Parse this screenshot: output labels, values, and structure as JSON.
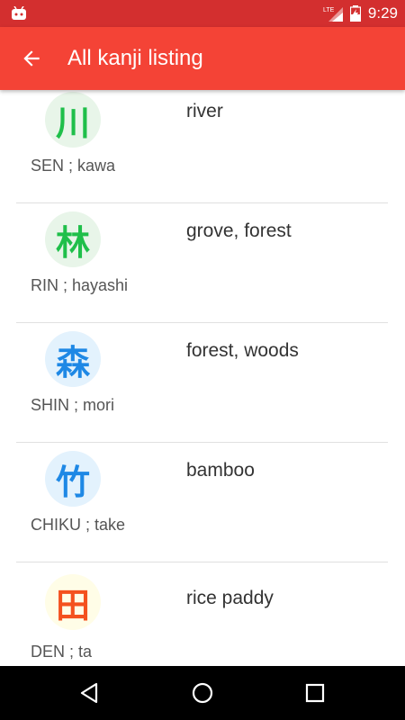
{
  "status_bar": {
    "time": "9:29",
    "network": "LTE"
  },
  "app_bar": {
    "title": "All kanji listing",
    "back_icon": "arrow-back-icon"
  },
  "items": [
    {
      "kanji": "川",
      "meaning": "river",
      "reading": "SEN ; kawa",
      "color": "#1fbf4a",
      "bg": "#e8f5e9"
    },
    {
      "kanji": "林",
      "meaning": "grove, forest",
      "reading": "RIN ; hayashi",
      "color": "#1fbf4a",
      "bg": "#e8f5e9"
    },
    {
      "kanji": "森",
      "meaning": "forest, woods",
      "reading": "SHIN ; mori",
      "color": "#1e88e5",
      "bg": "#e3f2fd"
    },
    {
      "kanji": "竹",
      "meaning": "bamboo",
      "reading": "CHIKU ; take",
      "color": "#1e88e5",
      "bg": "#e3f2fd"
    },
    {
      "kanji": "田",
      "meaning": "rice paddy",
      "reading": "DEN ; ta",
      "color": "#f4511e",
      "bg": "#fffde7"
    }
  ],
  "nav_bar": {
    "back": "triangle-back-icon",
    "home": "circle-home-icon",
    "recents": "square-recents-icon"
  }
}
